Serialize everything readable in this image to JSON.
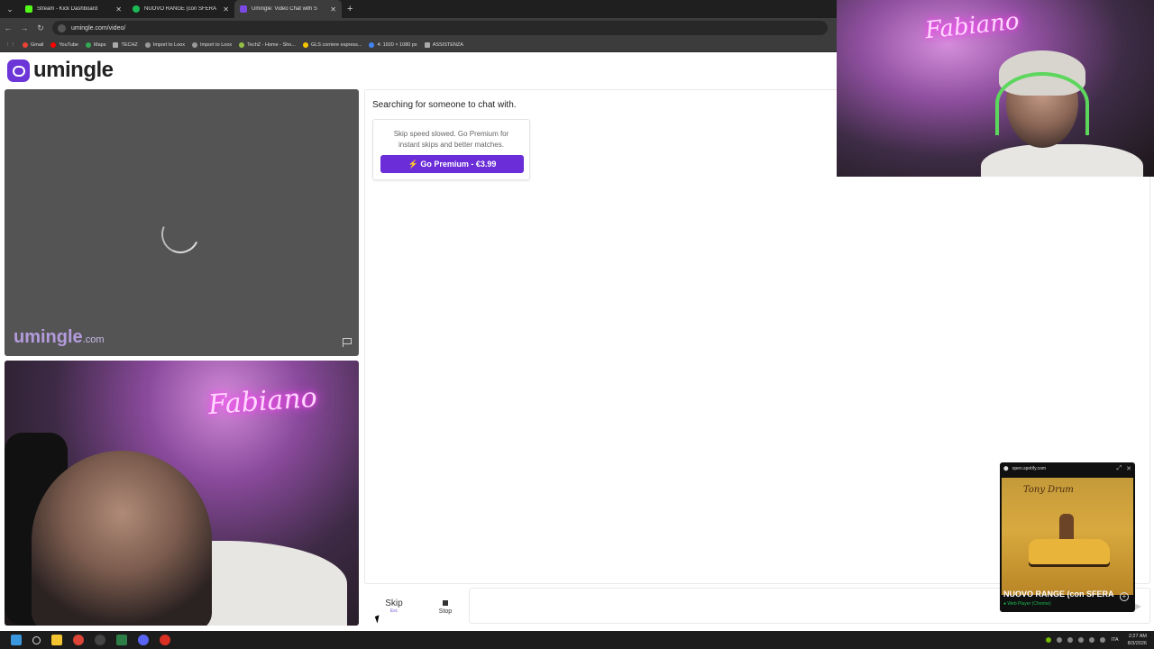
{
  "browser": {
    "tabs": [
      {
        "title": "Stream - Kick Dashboard",
        "favicon_color": "#53fc18",
        "active": false
      },
      {
        "title": "NUOVO RANGE (con SFERA",
        "favicon_color": "#1db954",
        "active": false
      },
      {
        "title": "Umingle: Video Chat with S",
        "favicon_color": "#7b4ae2",
        "active": true
      }
    ],
    "url": "umingle.com/video/",
    "bookmarks": [
      "Gmail",
      "YouTube",
      "Maps",
      "TECHZ",
      "Import to Loox",
      "Import to Loox",
      "TechZ - Home - Sho...",
      "GLS corriere espress...",
      "4: 1920 × 1080 px",
      "ASSISTENZA"
    ]
  },
  "site": {
    "logo_text": "umingle",
    "watermark": "umingle",
    "watermark_suffix": ".com",
    "webcam_neon": "Fabiano"
  },
  "chat": {
    "status": "Searching for someone to chat with.",
    "premium_message": "Skip speed slowed. Go Premium for instant skips and better matches.",
    "premium_button": "⚡ Go Premium - €3.99",
    "input_value": ""
  },
  "controls": {
    "skip_label": "Skip",
    "skip_key": "Esc",
    "stop_label": "Stop"
  },
  "spotify": {
    "domain": "open.spotify.com",
    "track": "NUOVO RANGE (con SFERA",
    "source": "● Web Player (Chrome)",
    "art_signature": "Tony Drum"
  },
  "taskbar": {
    "tray_lang": "ITA",
    "time": "2:27 AM",
    "date": "8/3/2026"
  }
}
